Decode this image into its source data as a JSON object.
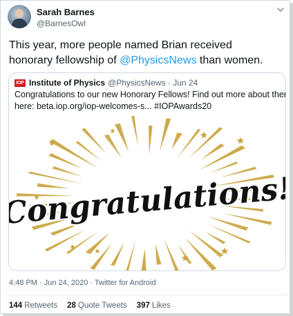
{
  "tweet": {
    "author_name": "Sarah Barnes",
    "author_handle": "@BarnesOwl",
    "text_line1": "This year, more people named Brian received",
    "text_line2_prefix": "honorary fellowship of ",
    "text_line2_mention": "@PhysicsNews",
    "text_line2_suffix": " than women.",
    "timestamp": "4:48 PM · Jun 24, 2020 · Twitter for Android"
  },
  "quoted_tweet": {
    "logo_text": "IOP",
    "author_name": "Institute of Physics",
    "meta": "@PhysicsNews · Jun 24",
    "text_line1": "Congratulations to our new Honorary Fellows! Find out more about there",
    "text_line2": "here: beta.iop.org/iop-welcomes-s... #IOPAwards20",
    "image_text": "Congratulations!"
  },
  "stats": [
    {
      "count": "144",
      "label": "Retweets"
    },
    {
      "count": "28",
      "label": "Quote Tweets"
    },
    {
      "count": "397",
      "label": "Likes"
    }
  ],
  "colors": {
    "accent": "#1d9bf0",
    "gold": "#c9a23a",
    "iop_red": "#d71920"
  },
  "icons": {
    "more": "chevron-down-icon"
  }
}
